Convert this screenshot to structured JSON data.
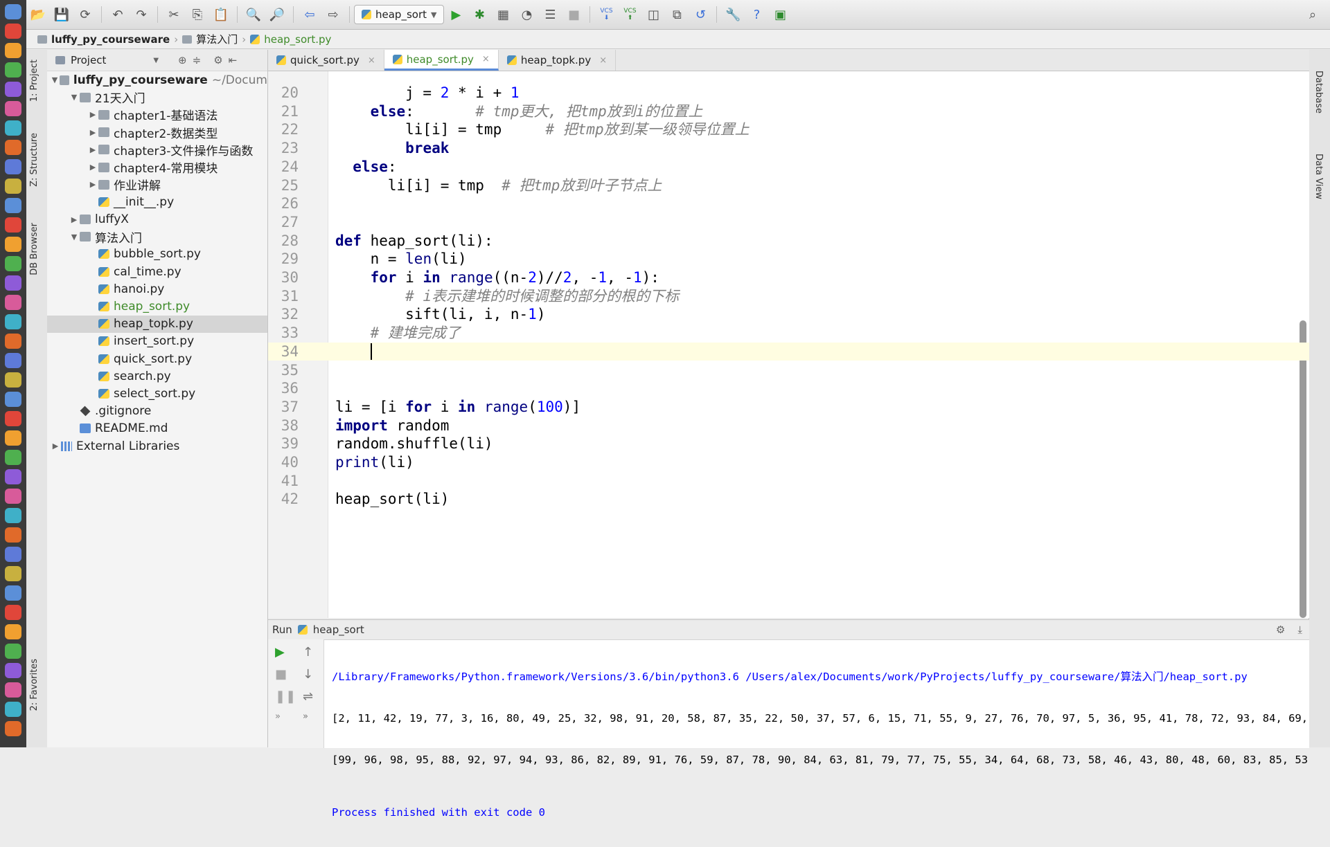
{
  "toolbar": {
    "run_config": "heap_sort",
    "vcs_label_1": "VCS",
    "vcs_label_2": "VCS"
  },
  "breadcrumb": [
    "luffy_py_courseware",
    "算法入门",
    "heap_sort.py"
  ],
  "side_tabs": {
    "project": "1: Project",
    "structure": "Z: Structure",
    "db_browser": "DB Browser",
    "favorites": "2: Favorites",
    "database": "Database",
    "data_view": "Data View"
  },
  "project": {
    "header": "Project",
    "root_label": "luffy_py_courseware",
    "root_path": "~/Docum",
    "tree": [
      {
        "label": "21天入门",
        "type": "folder",
        "arrow": "▼",
        "indent": 1
      },
      {
        "label": "chapter1-基础语法",
        "type": "folder",
        "arrow": "▶",
        "indent": 2
      },
      {
        "label": "chapter2-数据类型",
        "type": "folder",
        "arrow": "▶",
        "indent": 2
      },
      {
        "label": "chapter3-文件操作与函数",
        "type": "folder",
        "arrow": "▶",
        "indent": 2
      },
      {
        "label": "chapter4-常用模块",
        "type": "folder",
        "arrow": "▶",
        "indent": 2
      },
      {
        "label": "作业讲解",
        "type": "folder",
        "arrow": "▶",
        "indent": 2
      },
      {
        "label": "__init__.py",
        "type": "py",
        "arrow": "",
        "indent": 2
      },
      {
        "label": "luffyX",
        "type": "folder",
        "arrow": "▶",
        "indent": 1
      },
      {
        "label": "算法入门",
        "type": "folder",
        "arrow": "▼",
        "indent": 1
      },
      {
        "label": "bubble_sort.py",
        "type": "py",
        "arrow": "",
        "indent": 2
      },
      {
        "label": "cal_time.py",
        "type": "py",
        "arrow": "",
        "indent": 2
      },
      {
        "label": "hanoi.py",
        "type": "py",
        "arrow": "",
        "indent": 2
      },
      {
        "label": "heap_sort.py",
        "type": "py",
        "arrow": "",
        "indent": 2,
        "modified": true
      },
      {
        "label": "heap_topk.py",
        "type": "py",
        "arrow": "",
        "indent": 2,
        "selected": true
      },
      {
        "label": "insert_sort.py",
        "type": "py",
        "arrow": "",
        "indent": 2
      },
      {
        "label": "quick_sort.py",
        "type": "py",
        "arrow": "",
        "indent": 2
      },
      {
        "label": "search.py",
        "type": "py",
        "arrow": "",
        "indent": 2
      },
      {
        "label": "select_sort.py",
        "type": "py",
        "arrow": "",
        "indent": 2
      },
      {
        "label": ".gitignore",
        "type": "git",
        "arrow": "",
        "indent": 1
      },
      {
        "label": "README.md",
        "type": "md",
        "arrow": "",
        "indent": 1
      },
      {
        "label": "External Libraries",
        "type": "lib",
        "arrow": "▶",
        "indent": 0
      }
    ]
  },
  "editor_tabs": [
    {
      "label": "quick_sort.py",
      "active": false
    },
    {
      "label": "heap_sort.py",
      "active": true
    },
    {
      "label": "heap_topk.py",
      "active": false
    }
  ],
  "code": [
    {
      "n": "20",
      "html": "        j = <span class=\"nm\">2</span> * i + <span class=\"nm\">1</span>"
    },
    {
      "n": "21",
      "html": "    <span class=\"kw\">else</span>:       <span class=\"cm\"># tmp更大, 把tmp放到i的位置上</span>"
    },
    {
      "n": "22",
      "html": "        li[i] = tmp     <span class=\"cm\"># 把tmp放到某一级领导位置上</span>"
    },
    {
      "n": "23",
      "html": "        <span class=\"kw\">break</span>"
    },
    {
      "n": "24",
      "html": "  <span class=\"kw\">else</span>:"
    },
    {
      "n": "25",
      "html": "      li[i] = tmp  <span class=\"cm\"># 把tmp放到叶子节点上</span>"
    },
    {
      "n": "26",
      "html": ""
    },
    {
      "n": "27",
      "html": ""
    },
    {
      "n": "28",
      "html": "<span class=\"kw\">def</span> heap_sort(li):"
    },
    {
      "n": "29",
      "html": "    n = <span class=\"bi\">len</span>(li)"
    },
    {
      "n": "30",
      "html": "    <span class=\"kw\">for</span> i <span class=\"kw\">in</span> <span class=\"bi\">range</span>((n-<span class=\"nm\">2</span>)//<span class=\"nm\">2</span>, -<span class=\"nm\">1</span>, -<span class=\"nm\">1</span>):"
    },
    {
      "n": "31",
      "html": "        <span class=\"cm\"># i表示建堆的时候调整的部分的根的下标</span>"
    },
    {
      "n": "32",
      "html": "        sift(li, i, n-<span class=\"nm\">1</span>)"
    },
    {
      "n": "33",
      "html": "    <span class=\"cm\"># 建堆完成了</span>"
    },
    {
      "n": "34",
      "html": "",
      "current": true
    },
    {
      "n": "35",
      "html": ""
    },
    {
      "n": "36",
      "html": ""
    },
    {
      "n": "37",
      "html": "li = [i <span class=\"kw\">for</span> i <span class=\"kw\">in</span> <span class=\"bi\">range</span>(<span class=\"nm\">100</span>)]"
    },
    {
      "n": "38",
      "html": "<span class=\"kw\">import</span> random"
    },
    {
      "n": "39",
      "html": "random.shuffle(li)"
    },
    {
      "n": "40",
      "html": "<span class=\"bi\">print</span>(li)"
    },
    {
      "n": "41",
      "html": ""
    },
    {
      "n": "42",
      "html": "heap_sort(li)"
    }
  ],
  "run": {
    "label": "Run",
    "config": "heap_sort",
    "command": "/Library/Frameworks/Python.framework/Versions/3.6/bin/python3.6 /Users/alex/Documents/work/PyProjects/luffy_py_courseware/算法入门/heap_sort.py",
    "output_line_1": "[2, 11, 42, 19, 77, 3, 16, 80, 49, 25, 32, 98, 91, 20, 58, 87, 35, 22, 50, 37, 57, 6, 15, 71, 55, 9, 27, 76, 70, 97, 5, 36, 95, 41, 78, 72, 93, 84, 69,",
    "output_line_2": "[99, 96, 98, 95, 88, 92, 97, 94, 93, 86, 82, 89, 91, 76, 59, 87, 78, 90, 84, 63, 81, 79, 77, 75, 55, 34, 64, 68, 73, 58, 46, 43, 80, 48, 60, 83, 85, 53,",
    "exit_message": "Process finished with exit code 0"
  },
  "colors": {
    "keyword": "#000080",
    "number": "#0000ff",
    "comment": "#808080",
    "modified_file": "#3f8b2a",
    "current_line": "#fffde1"
  }
}
